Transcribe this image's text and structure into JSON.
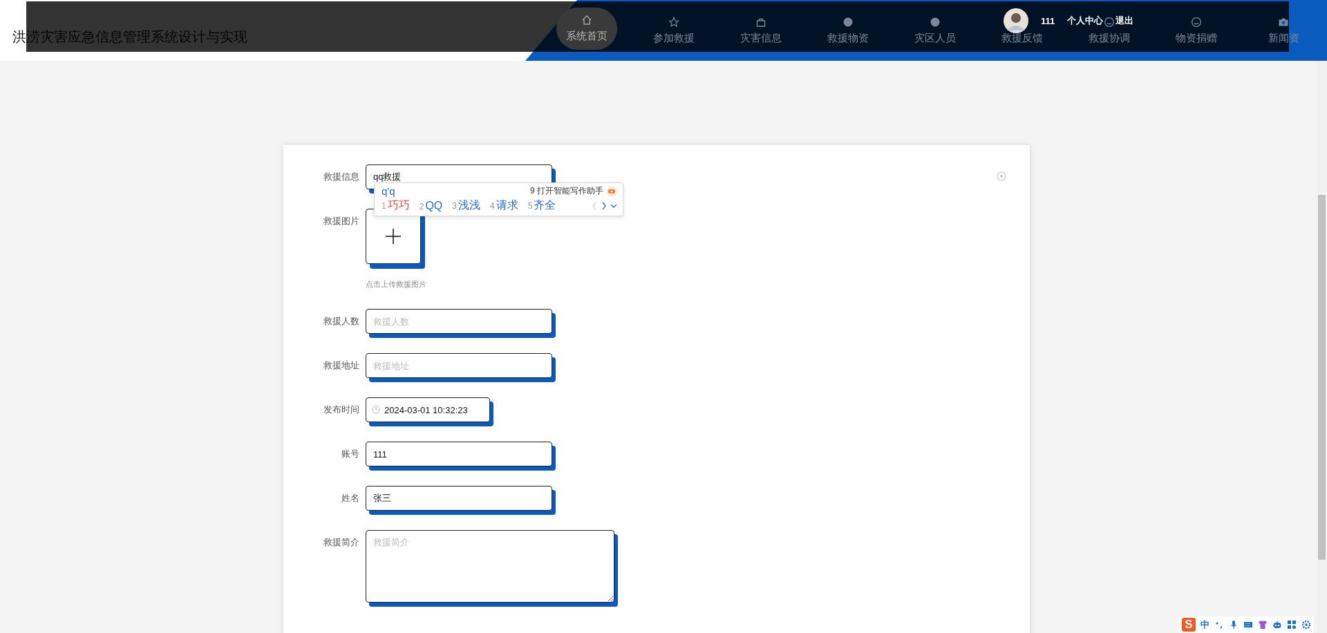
{
  "header": {
    "title": "洪涝灾害应急信息管理系统设计与实现",
    "nav": [
      {
        "label": "系统首页",
        "selected": true
      },
      {
        "label": "参加救援",
        "selected": false
      },
      {
        "label": "灾害信息",
        "selected": false
      },
      {
        "label": "救援物资",
        "selected": false
      },
      {
        "label": "灾区人员",
        "selected": false
      },
      {
        "label": "救援反馈",
        "selected": false
      },
      {
        "label": "救援协调",
        "selected": false
      },
      {
        "label": "物资捐赠",
        "selected": false
      },
      {
        "label": "新闻资",
        "selected": false
      }
    ],
    "user": {
      "name": "111",
      "links": [
        "个人中心",
        "退出"
      ]
    }
  },
  "form": {
    "fields": [
      {
        "kind": "text",
        "label": "救援信息",
        "value": "qq救援"
      },
      {
        "kind": "upload",
        "label": "救援图片",
        "hint": "点击上传救援图片"
      },
      {
        "kind": "text",
        "label": "救援人数",
        "placeholder": "救援人数"
      },
      {
        "kind": "text",
        "label": "救援地址",
        "placeholder": "救援地址"
      },
      {
        "kind": "datetime",
        "label": "发布时间",
        "value": "2024-03-01 10:32:23"
      },
      {
        "kind": "text",
        "label": "账号",
        "value": "111"
      },
      {
        "kind": "text",
        "label": "姓名",
        "value": "张三"
      },
      {
        "kind": "textarea",
        "label": "救援简介",
        "placeholder": "救援简介"
      }
    ]
  },
  "ime": {
    "composition": "q'q",
    "assistant": "9 打开智能写作助手",
    "candidates": [
      {
        "index": "1",
        "text": "巧巧",
        "selected": true
      },
      {
        "index": "2",
        "text": "QQ",
        "selected": false
      },
      {
        "index": "3",
        "text": "浅浅",
        "selected": false
      },
      {
        "index": "4",
        "text": "请求",
        "selected": false
      },
      {
        "index": "5",
        "text": "齐全",
        "selected": false
      }
    ]
  },
  "ime_toolbar": {
    "logo": "S",
    "mode": "中"
  }
}
